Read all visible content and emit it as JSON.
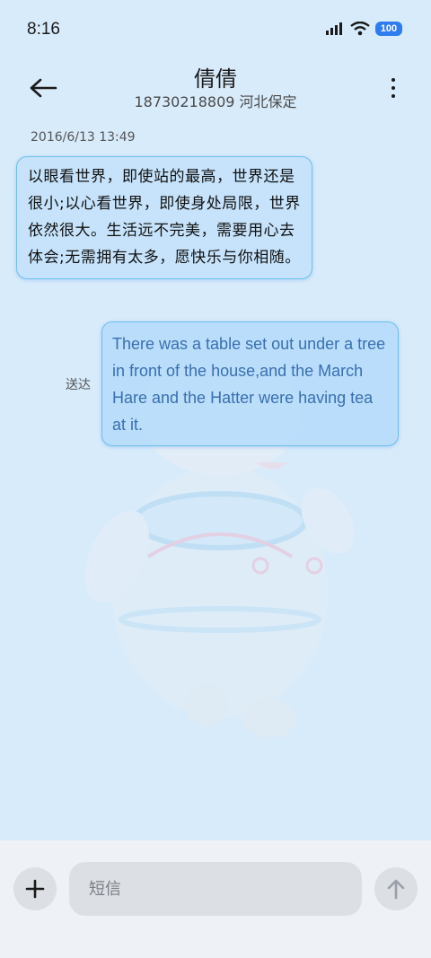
{
  "status_bar": {
    "time": "8:16",
    "battery": "100"
  },
  "header": {
    "contact_name": "倩倩",
    "contact_detail": "18730218809 河北保定"
  },
  "conversation": {
    "timestamp": "2016/6/13 13:49",
    "incoming_message": "以眼看世界，即使站的最高，世界还是很小;以心看世界，即使身处局限，世界依然很大。生活远不完美，需要用心去体会;无需拥有太多，愿快乐与你相随。",
    "outgoing_message": "There was a table set out under a tree in front of the house,and the March Hare and the Hatter were having tea at it.",
    "outgoing_status": "送达"
  },
  "composer": {
    "placeholder": "短信"
  },
  "colors": {
    "background": "#d8ebfb",
    "bubble_border": "#6cc0ef",
    "outgoing_text": "#3a6fb0",
    "battery_badge": "#2f7cf0"
  },
  "icons": [
    "back-arrow-icon",
    "more-vertical-icon",
    "signal-icon",
    "wifi-icon",
    "battery-icon",
    "plus-icon",
    "send-arrow-icon",
    "mascot-wallpaper"
  ]
}
